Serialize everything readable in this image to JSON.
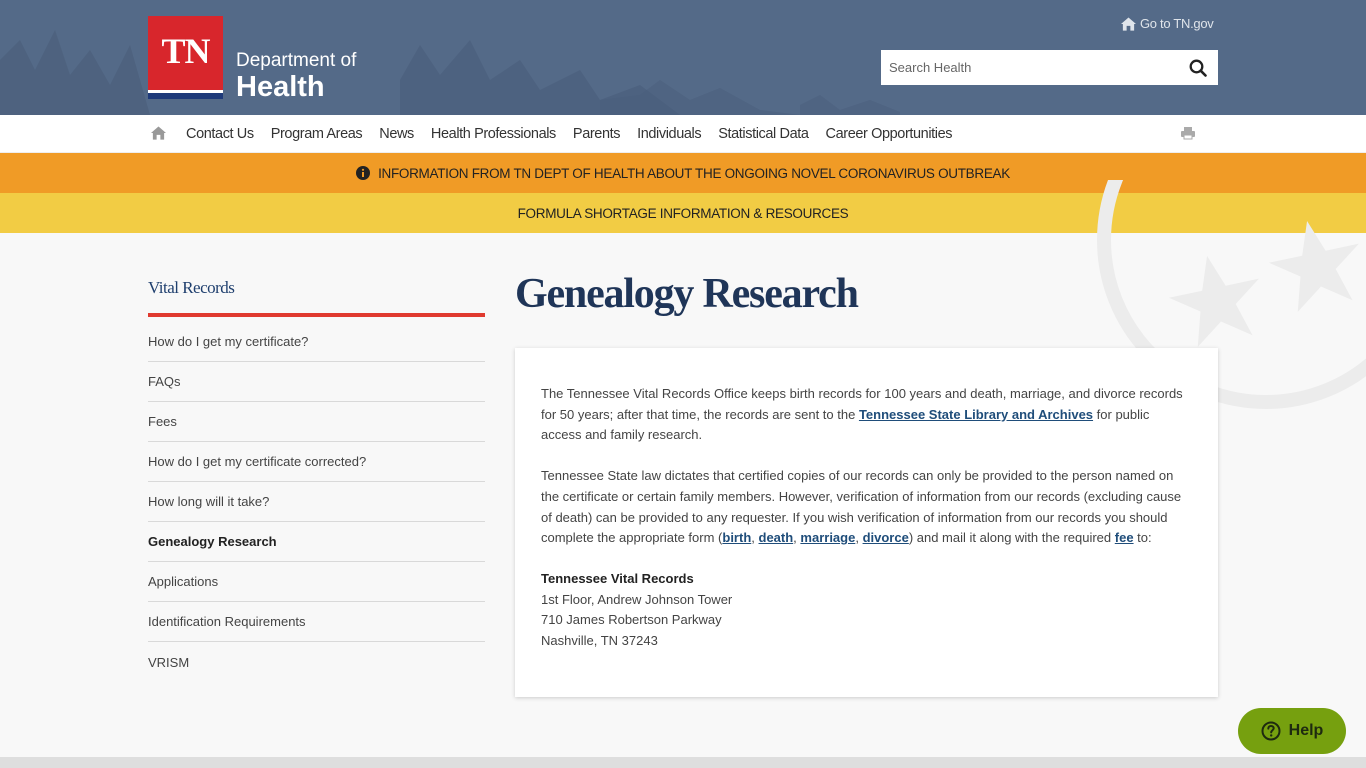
{
  "header": {
    "logo_text": "TN",
    "dept_line1": "Department of",
    "dept_line2": "Health",
    "go_tn_label": "Go to TN.gov",
    "search": {
      "placeholder": "Search Health",
      "value": ""
    }
  },
  "nav": {
    "items": [
      {
        "label": "Contact Us"
      },
      {
        "label": "Program Areas"
      },
      {
        "label": "News"
      },
      {
        "label": "Health Professionals"
      },
      {
        "label": "Parents"
      },
      {
        "label": "Individuals"
      },
      {
        "label": "Statistical Data"
      },
      {
        "label": "Career Opportunities"
      }
    ]
  },
  "banners": {
    "coronavirus": "INFORMATION FROM TN DEPT OF HEALTH ABOUT THE ONGOING NOVEL CORONAVIRUS OUTBREAK",
    "formula": "FORMULA SHORTAGE INFORMATION & RESOURCES"
  },
  "colors": {
    "header_bg": "#546a88",
    "logo_red": "#d8262c",
    "banner_orange": "#f09b26",
    "banner_yellow": "#f2cc44",
    "accent_red": "#e03a2f",
    "title_navy": "#1f3558",
    "link_blue": "#1f4d7a",
    "help_green": "#76a00f"
  },
  "sidebar": {
    "title": "Vital Records",
    "items": [
      {
        "label": "How do I get my certificate?",
        "active": false
      },
      {
        "label": "FAQs",
        "active": false
      },
      {
        "label": "Fees",
        "active": false
      },
      {
        "label": "How do I get my certificate corrected?",
        "active": false
      },
      {
        "label": "How long will it take?",
        "active": false
      },
      {
        "label": "Genealogy Research",
        "active": true
      },
      {
        "label": "Applications",
        "active": false
      },
      {
        "label": "Identification Requirements",
        "active": false
      },
      {
        "label": "VRISM",
        "active": false
      }
    ]
  },
  "main": {
    "title": "Genealogy Research",
    "para1": {
      "before": "The Tennessee Vital Records Office keeps birth records for 100 years and death, marriage, and divorce records for 50 years; after that time, the records are sent to the ",
      "link": "Tennessee State Library and Archives",
      "after": " for public access and family research."
    },
    "para2": {
      "text1": "Tennessee State law dictates that certified copies of our records can only be provided to the person named on the certificate or certain family members.  However, verification of information from our records (excluding cause of death) can be provided to any requester.  If you wish verification of information from our records you should complete the appropriate form (",
      "link_birth": "birth",
      "sep1": ", ",
      "link_death": "death",
      "sep2": ", ",
      "link_marriage": "marriage",
      "sep3": ", ",
      "link_divorce": "divorce",
      "text2": ") and mail it along with the required ",
      "link_fee": "fee",
      "text3": " to:"
    },
    "address": {
      "name": "Tennessee Vital Records",
      "line1": "1st Floor, Andrew Johnson Tower",
      "line2": "710 James Robertson Parkway",
      "line3": "Nashville, TN 37243"
    }
  },
  "help": {
    "label": "Help"
  }
}
